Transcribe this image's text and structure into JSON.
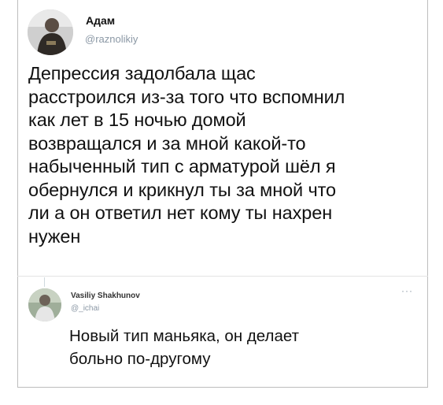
{
  "tweet": {
    "author_name": "Адам",
    "author_handle": "@raznolikiy",
    "text_lines": [
      "Депрессия задолбала щас",
      "расстроился из-за того что вспомнил",
      "как лет в 15 ночью домой",
      "возвращался и за мной какой-то",
      "набыченный тип с арматурой шёл я",
      "обернулся и крикнул ты за мной что",
      "ли а он ответил нет кому ты нахрен",
      "нужен"
    ]
  },
  "reply": {
    "author_name": "Vasiliy Shakhunov",
    "author_handle": "@_ichai",
    "more_label": "···",
    "text_lines": [
      "Новый тип маньяка, он делает",
      "больно по-другому"
    ]
  }
}
